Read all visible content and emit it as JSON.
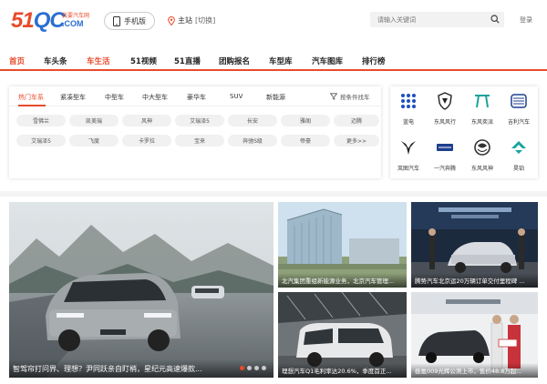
{
  "header": {
    "logo_text": "51QC",
    "logo_suffix": ".COM",
    "logo_tag": "我要汽车网",
    "mobile_label": "手机版",
    "station_label": "主站",
    "station_switch": "[切换]",
    "search_placeholder": "请输入关键词",
    "login_label": "登录"
  },
  "nav": {
    "items": [
      "首页",
      "车头条",
      "车生活",
      "51视频",
      "51直播",
      "团购报名",
      "车型库",
      "汽车图库",
      "排行榜"
    ],
    "active_index": 2,
    "accent_color": "#e84b2b"
  },
  "car_panel": {
    "tabs": [
      "热门车系",
      "紧凑型车",
      "中型车",
      "中大型车",
      "豪华车",
      "SUV",
      "新能源"
    ],
    "active_tab": 0,
    "filter_label": "按条件找车",
    "models": [
      "雪佛兰",
      "凯美瑞",
      "风神",
      "艾瑞泽5",
      "长安",
      "雅阁",
      "迈腾",
      "艾瑞泽5",
      "飞度",
      "卡罗拉",
      "宝来",
      "奔驰S级",
      "帝豪",
      "更多>>"
    ]
  },
  "brands": [
    {
      "name": "蓝电",
      "icon": "dots-logo-icon",
      "color": "#1f4fbf"
    },
    {
      "name": "东风风行",
      "icon": "shield-logo-icon",
      "color": "#222222"
    },
    {
      "name": "东风奕派",
      "icon": "eπ-logo-icon",
      "color": "#1aa39a"
    },
    {
      "name": "吉利汽车",
      "icon": "geely-logo-icon",
      "color": "#1d3f8f"
    },
    {
      "name": "岚图汽车",
      "icon": "voyah-logo-icon",
      "color": "#222222"
    },
    {
      "name": "一汽奔腾",
      "icon": "bestune-logo-icon",
      "color": "#1d3f8f"
    },
    {
      "name": "东风风神",
      "icon": "aeolus-logo-icon",
      "color": "#333333"
    },
    {
      "name": "昊铂",
      "icon": "hyper-logo-icon",
      "color": "#17a3a0"
    }
  ],
  "news": {
    "hero_caption": "智驾帘打问界、理想？尹同跃亲自盯梢，星纪元高速爆款...",
    "thumbs": [
      "北汽集团重组新能源业务，北京汽车管理...",
      "腾势汽车北京运20万辆订单交付里程碑 ...",
      "理想汽车Q1毛利率达20.6%，季度首正...",
      "极氪009光辉公测上市，售价48.8万起..."
    ]
  }
}
